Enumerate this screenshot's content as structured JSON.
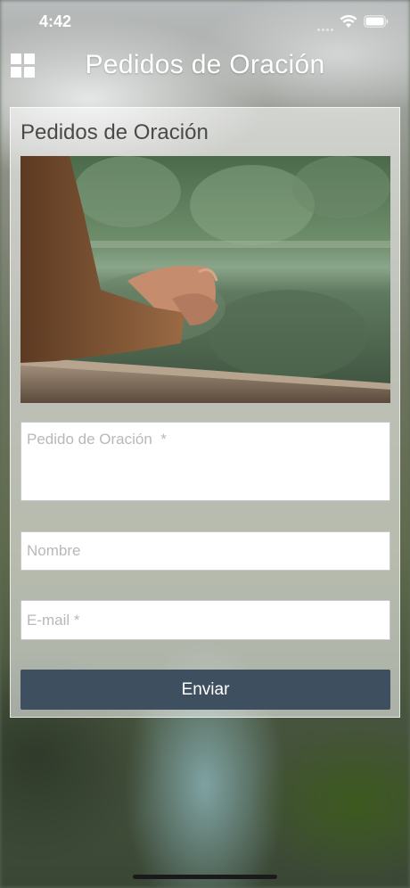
{
  "status_bar": {
    "time": "4:42"
  },
  "header": {
    "title": "Pedidos de Oración"
  },
  "card": {
    "title": "Pedidos de Oración",
    "fields": {
      "prayer_placeholder": "Pedido de Oración  *",
      "name_placeholder": "Nombre",
      "email_placeholder": "E-mail *"
    },
    "submit_label": "Enviar"
  },
  "icons": [
    "grid-menu-icon",
    "wifi-icon",
    "battery-icon"
  ],
  "colors": {
    "submit_button": "#3e505f",
    "text_white": "#ffffff"
  }
}
